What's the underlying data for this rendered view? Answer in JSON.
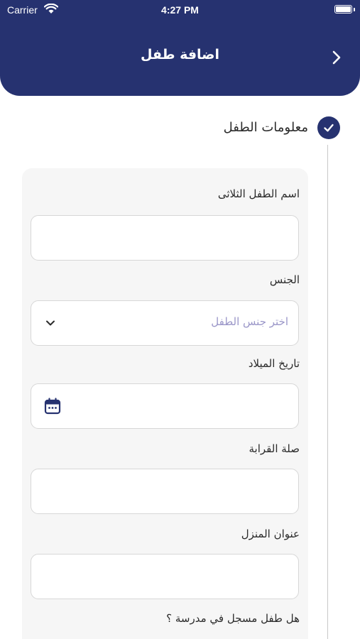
{
  "status_bar": {
    "carrier": "Carrier",
    "time": "4:27 PM"
  },
  "header": {
    "title": "اضافة طفل",
    "back_icon": "chevron-right-icon",
    "background_color": "#263270"
  },
  "stepper": {
    "step_label": "معلومات الطفل",
    "step_icon": "check-icon",
    "completed": true
  },
  "form": {
    "full_name": {
      "label": "اسم الطفل الثلاثى",
      "value": ""
    },
    "gender": {
      "label": "الجنس",
      "placeholder": "اختر جنس الطفل",
      "icon": "chevron-down-icon"
    },
    "birth_date": {
      "label": "تاريخ الميلاد",
      "value": "",
      "icon": "calendar-icon"
    },
    "relation": {
      "label": "صلة القرابة",
      "value": ""
    },
    "address": {
      "label": "عنوان المنزل",
      "value": ""
    },
    "school_question": {
      "label": "هل طفل مسجل في مدرسة ؟"
    }
  },
  "colors": {
    "accent": "#263270",
    "placeholder": "#9a96c8",
    "card_background": "#f6f6f6",
    "field_border": "#d7d7d7"
  }
}
